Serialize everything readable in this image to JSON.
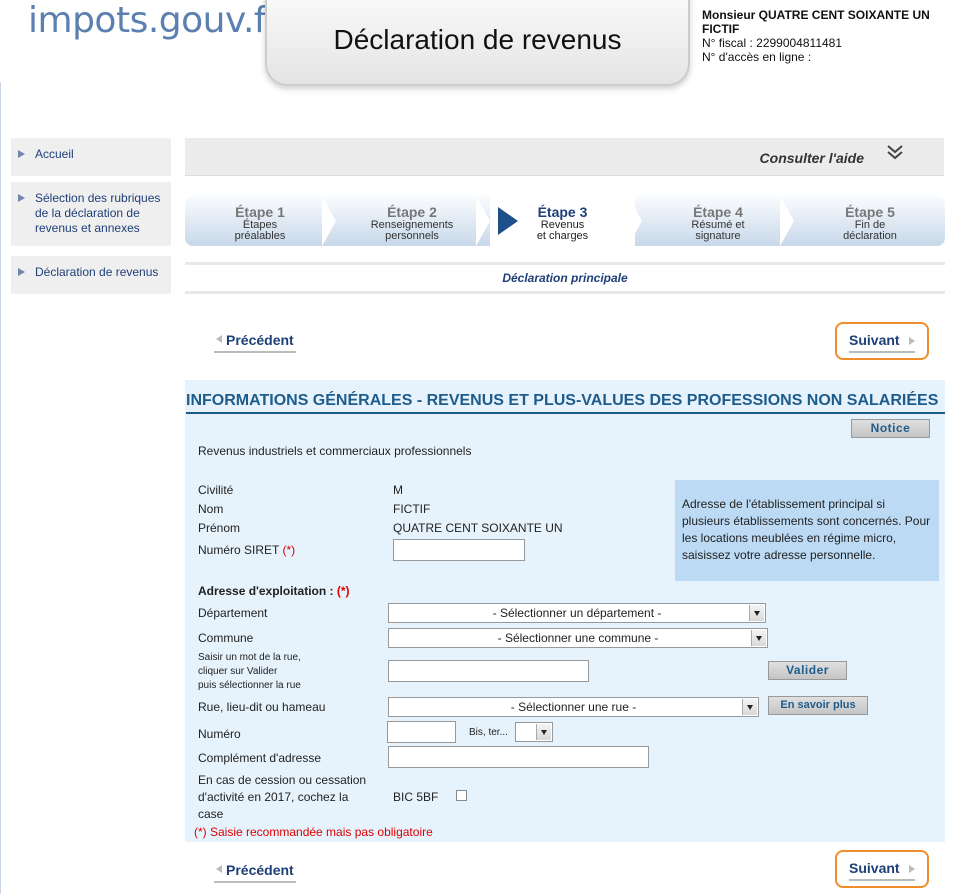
{
  "header": {
    "logo": "impots.gouv.fr",
    "title": "Déclaration de revenus",
    "user_name": "Monsieur QUATRE CENT SOIXANTE UN FICTIF",
    "fiscal_number": "N° fiscal : 2299004811481",
    "access_number": "N° d'accès en ligne :"
  },
  "sidebar": {
    "items": [
      {
        "label": "Accueil"
      },
      {
        "label": "Sélection des rubriques de la déclaration de revenus et annexes"
      },
      {
        "label": "Déclaration de revenus"
      }
    ]
  },
  "help": {
    "label": "Consulter l'aide",
    "icon": "double-chevron-down-icon"
  },
  "steps": [
    {
      "title": "Étape 1",
      "line1": "Étapes",
      "line2": "préalables"
    },
    {
      "title": "Étape 2",
      "line1": "Renseignements",
      "line2": "personnels"
    },
    {
      "title": "Étape 3",
      "line1": "Revenus",
      "line2": "et charges"
    },
    {
      "title": "Étape 4",
      "line1": "Résumé et",
      "line2": "signature"
    },
    {
      "title": "Étape 5",
      "line1": "Fin de",
      "line2": "déclaration"
    }
  ],
  "active_step": 3,
  "declaration_label": "Déclaration principale",
  "nav": {
    "prev_label": "Précédent",
    "next_label": "Suivant"
  },
  "form": {
    "title": "INFORMATIONS GÉNÉRALES - REVENUS ET PLUS-VALUES DES PROFESSIONS NON SALARIÉES",
    "notice_button": "Notice",
    "section_label": "Revenus industriels et commerciaux professionnels",
    "civilite_label": "Civilité",
    "civilite_value": "M",
    "nom_label": "Nom",
    "nom_value": "FICTIF",
    "prenom_label": "Prénom",
    "prenom_value": "QUATRE CENT SOIXANTE UN",
    "siret_label": "Numéro SIRET",
    "siret_value": "",
    "req_marker": "(*)",
    "info_text": "Adresse de l'établissement principal si plusieurs établissements sont concernés. Pour les locations meublées en régime micro, saisissez votre adresse personnelle.",
    "address_heading": "Adresse d'exploitation :",
    "departement_label": "Département",
    "departement_value": "- Sélectionner un département -",
    "commune_label": "Commune",
    "commune_value": "- Sélectionner une commune -",
    "street_search_line1": "Saisir un mot de la rue,",
    "street_search_line2": "cliquer sur Valider",
    "street_search_line3": "puis sélectionner la rue",
    "street_search_value": "",
    "valider_button": "Valider",
    "rue_label": "Rue, lieu-dit ou hameau",
    "rue_value": "- Sélectionner une rue -",
    "en_savoir_plus_button": "En savoir plus",
    "numero_label": "Numéro",
    "numero_value": "",
    "bis_label": "Bis, ter...",
    "bis_value": "",
    "complement_label": "Complément d'adresse",
    "complement_value": "",
    "cession_line1": "En cas de cession ou cessation",
    "cession_line2": "d'activité en 2017, cochez la",
    "cession_line3": "case",
    "bic_label": "BIC 5BF",
    "bic_checked": false,
    "footnote": "(*) Saisie recommandée mais pas obligatoire"
  },
  "colors": {
    "accent": "#1e3f78",
    "panel_bg": "#e7f3fc",
    "next_border": "#f08c2a",
    "required": "#dd0000"
  }
}
